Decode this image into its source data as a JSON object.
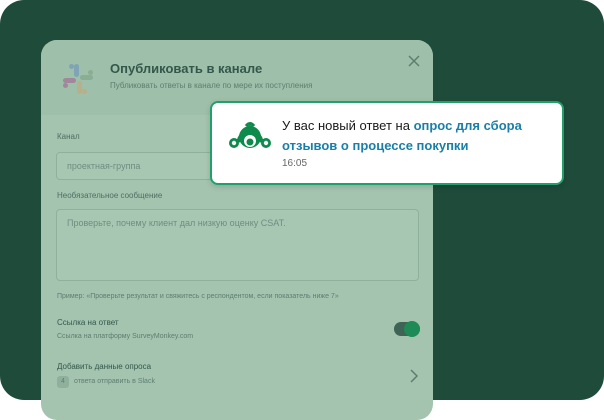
{
  "dialog": {
    "title": "Опубликовать в канале",
    "subtitle": "Публиковать ответы в канале по мере их поступления",
    "channel_label": "Канал",
    "channel_value": "проектная-группа",
    "message_label": "Необязательное сообщение",
    "message_placeholder": "Проверьте, почему клиент дал низкую оценку CSAT.",
    "example_hint": "Пример: «Проверьте результат и свяжитесь с респондентом, если показатель ниже 7»",
    "link_label": "Ссылка на ответ",
    "link_desc": "Ссылка на платформу SurveyMonkey.com",
    "link_enabled": true,
    "add_data_label": "Добавить данные опроса",
    "add_data_count": "4",
    "add_data_desc": "ответа отправить в Slack"
  },
  "notification": {
    "text_prefix": "У вас новый ответ на",
    "link_text_1": "опрос для сбора",
    "link_text_2": "отзывов о процессе покупки",
    "time": "16:05",
    "accent_color": "#22a06b",
    "link_color": "#1a7fa8"
  },
  "icons": {
    "app_logo": "slack-logo-icon",
    "close": "close-icon",
    "chevron": "chevron-right-icon",
    "notification_logo": "surveymonkey-logo-icon"
  }
}
